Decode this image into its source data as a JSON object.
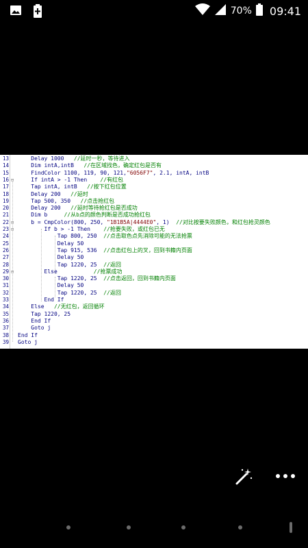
{
  "status_bar": {
    "icons_left": [
      "image-icon",
      "battery-plus-icon"
    ],
    "icons_right": [
      "wifi-icon",
      "signal-icon"
    ],
    "battery": "70%",
    "time": "09:41"
  },
  "code_lines": [
    {
      "n": "13",
      "code": "    Delay 1000   //延时一秒，等待进入"
    },
    {
      "n": "14",
      "code": "    Dim intA,intB   //在区域找色，确定红包是否有"
    },
    {
      "n": "15",
      "code": "    FindColor 1100, 119, 90, 121,\"6056F7\", 2.1, intA, intB"
    },
    {
      "n": "16",
      "code": "    If intA > -1 Then    //有红包"
    },
    {
      "n": "17",
      "code": "    Tap intA, intB   //按下红包位置"
    },
    {
      "n": "18",
      "code": "    Delay 200   //延时"
    },
    {
      "n": "19",
      "code": "    Tap 500, 350   //点击抢红包"
    },
    {
      "n": "20",
      "code": "    Delay 200   //延时等待抢红包是否成功"
    },
    {
      "n": "21",
      "code": "    Dim b     //从b点的颜色判断是否成功抢红包"
    },
    {
      "n": "22",
      "code": "    b = CmpColor(800, 250, \"1B1B5A|4444E0\", 1)  //对比按要失败颜色，和红包抢灵颜色"
    },
    {
      "n": "23",
      "code": "        If b > -1 Then    //抢要失败，或红包已无"
    },
    {
      "n": "24",
      "code": "            Tap 800, 250  //点击取色点先消除可能的无法抢票"
    },
    {
      "n": "25",
      "code": "            Delay 50"
    },
    {
      "n": "26",
      "code": "            Tap 915, 536  //点击红包上的叉，回到书籍内页面"
    },
    {
      "n": "27",
      "code": "            Delay 50"
    },
    {
      "n": "28",
      "code": "            Tap 1220, 25  //返回"
    },
    {
      "n": "29",
      "code": "        Else           //抢票成功"
    },
    {
      "n": "30",
      "code": "            Tap 1220, 25  //点击返回，回到书籍内页面"
    },
    {
      "n": "31",
      "code": "            Delay 50"
    },
    {
      "n": "32",
      "code": "            Tap 1220, 25  //返回"
    },
    {
      "n": "33",
      "code": "        End If"
    },
    {
      "n": "34",
      "code": "    Else   //无红包，返回循环"
    },
    {
      "n": "35",
      "code": "    Tap 1220, 25"
    },
    {
      "n": "36",
      "code": "    End If"
    },
    {
      "n": "37",
      "code": "    Goto j"
    },
    {
      "n": "38",
      "code": "End If"
    },
    {
      "n": "39",
      "code": "Goto j"
    }
  ],
  "toolbar": {
    "edit_icon": "magic-wand-icon",
    "more_icon": "more-options-icon"
  }
}
